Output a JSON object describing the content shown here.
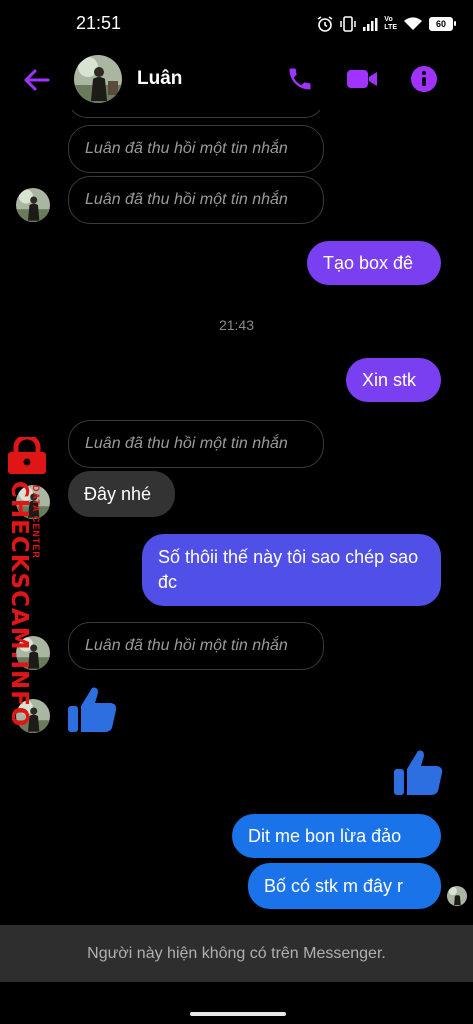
{
  "status_bar": {
    "time": "21:51",
    "network_label_top": "Vo",
    "network_label_bottom": "LTE",
    "battery": "60"
  },
  "header": {
    "contact_name": "Luân",
    "accent_color": "#a033ff"
  },
  "messages": {
    "unsent_1": "Luân đã thu hồi một tin nhắn",
    "unsent_2": "Luân đã thu hồi một tin nhắn",
    "out_1": "Tạo box đê",
    "timestamp": "21:43",
    "out_2": "Xin stk",
    "unsent_3": "Luân đã thu hồi một tin nhắn",
    "in_1": "Đây nhé",
    "out_3": "Số thôii thế này tôi sao chép sao đc",
    "unsent_4": "Luân đã thu hồi một tin nhắn",
    "out_4": "Dit me bon lừa đảo",
    "out_5": "Bố có stk m đây r"
  },
  "watermark": {
    "main": "CHECKSCAM.INFO",
    "sub": "DATA CENTER",
    "color": "#e01616"
  },
  "footer": {
    "notice": "Người này hiện không có trên Messenger."
  },
  "icons": {
    "back": "arrow-left-icon",
    "call": "phone-icon",
    "video": "video-camera-icon",
    "info": "info-icon",
    "like": "thumbs-up-icon"
  },
  "colors": {
    "unsent_border": "#3a3a3a",
    "incoming_bubble": "#333333",
    "outgoing_purple": "#7b3ff2",
    "outgoing_indigo": "#5050e8",
    "outgoing_blue": "#1a73e8",
    "like_blue": "#2d6fe0"
  }
}
